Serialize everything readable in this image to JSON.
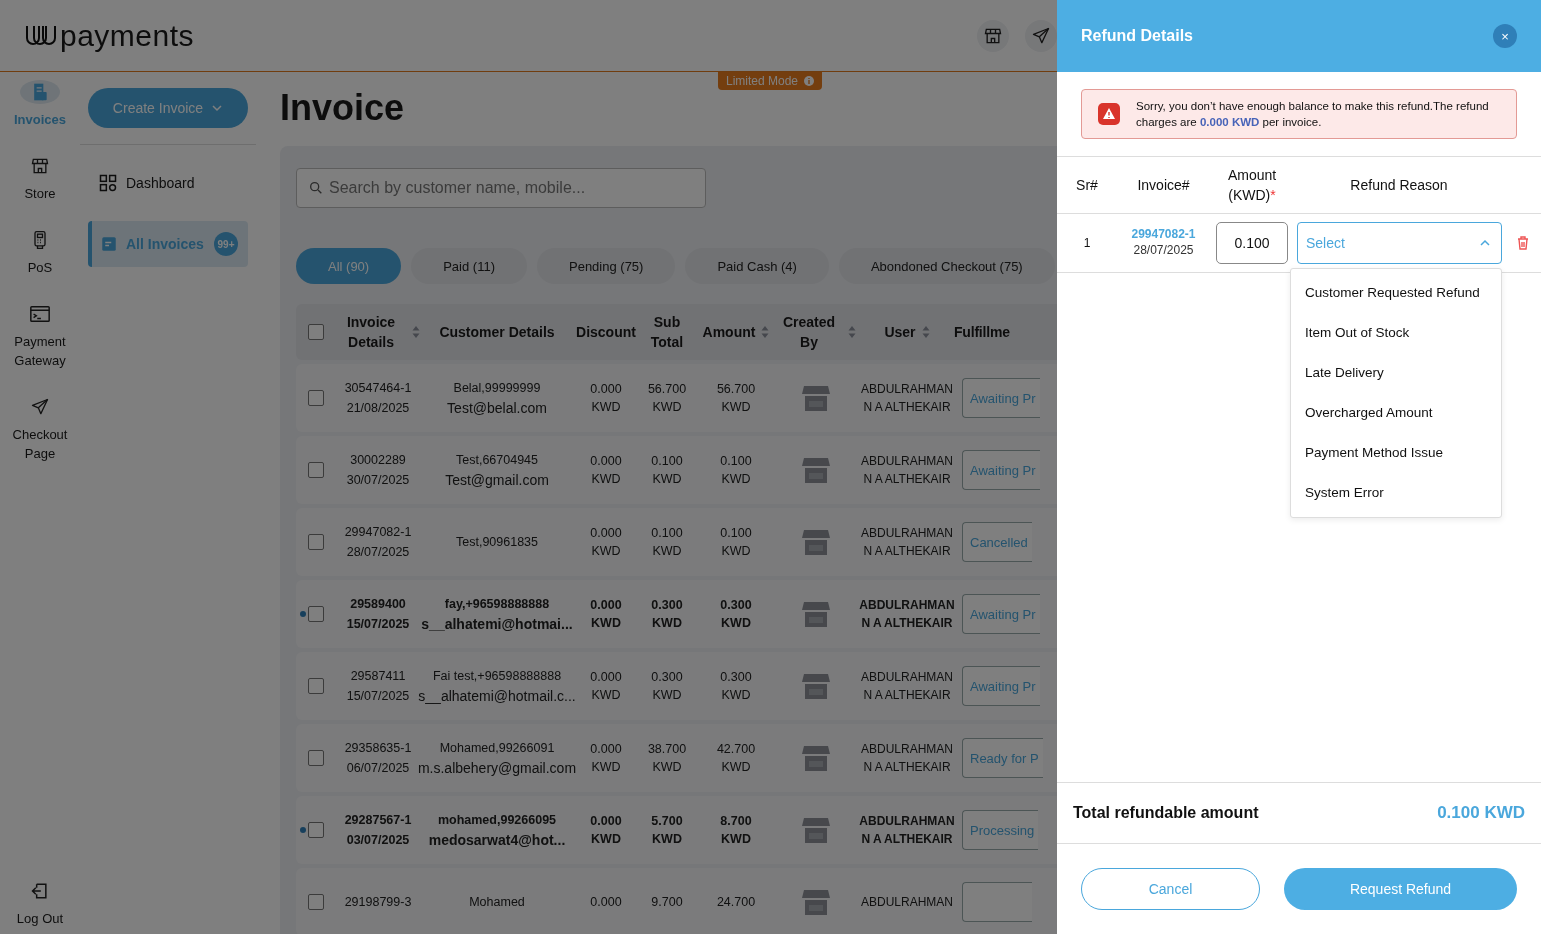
{
  "header": {
    "logo_text": "payments",
    "limited_mode": "Limited Mode"
  },
  "rail": {
    "items": [
      {
        "label": "Invoices",
        "selected": true
      },
      {
        "label": "Store",
        "selected": false
      },
      {
        "label": "PoS",
        "selected": false
      },
      {
        "label": "Payment Gateway",
        "selected": false
      },
      {
        "label": "Checkout Page",
        "selected": false
      }
    ],
    "logout": "Log Out"
  },
  "submenu": {
    "create_button": "Create Invoice",
    "items": [
      {
        "label": "Dashboard",
        "selected": false
      },
      {
        "label": "All Invoices",
        "selected": true,
        "badge": "99+"
      }
    ]
  },
  "page_title": "Invoice",
  "search": {
    "placeholder": "Search by customer name, mobile..."
  },
  "filters": [
    {
      "label": "All (90)",
      "selected": true
    },
    {
      "label": "Paid (11)",
      "selected": false
    },
    {
      "label": "Pending (75)",
      "selected": false
    },
    {
      "label": "Paid Cash (4)",
      "selected": false
    },
    {
      "label": "Abondoned Checkout (75)",
      "selected": false
    }
  ],
  "table": {
    "all_checked": false,
    "columns": [
      {
        "label": "Invoice Details",
        "sortable": true
      },
      {
        "label": "Customer Details",
        "sortable": false
      },
      {
        "label": "Discount",
        "sortable": false
      },
      {
        "label": "Sub Total",
        "sortable": false
      },
      {
        "label": "Amount",
        "sortable": true
      },
      {
        "label": "Created By",
        "sortable": true
      },
      {
        "label": "User",
        "sortable": true
      },
      {
        "label": "Fulfillme",
        "sortable": false
      }
    ],
    "rows": [
      {
        "invoice": "30547464-1",
        "date": "21/08/2025",
        "customer": "Belal,99999999",
        "email": "Test@belal.com",
        "discount": "0.000 KWD",
        "subtotal": "56.700 KWD",
        "amount": "56.700 KWD",
        "user": "ABDULRAHMAN N A ALTHEKAIR",
        "status": "Awaiting Pr",
        "unread": false,
        "checked": false
      },
      {
        "invoice": "30002289",
        "date": "30/07/2025",
        "customer": "Test,66704945",
        "email": "Test@gmail.com",
        "discount": "0.000 KWD",
        "subtotal": "0.100 KWD",
        "amount": "0.100 KWD",
        "user": "ABDULRAHMAN N A ALTHEKAIR",
        "status": "Awaiting Pr",
        "unread": false,
        "checked": false
      },
      {
        "invoice": "29947082-1",
        "date": "28/07/2025",
        "customer": "Test,90961835",
        "discount": "0.000 KWD",
        "subtotal": "0.100 KWD",
        "amount": "0.100 KWD",
        "user": "ABDULRAHMAN N A ALTHEKAIR",
        "status": "Cancelled",
        "unread": false,
        "checked": false
      },
      {
        "invoice": "29589400",
        "date": "15/07/2025",
        "customer": "fay,+96598888888",
        "email": "s__alhatemi@hotmai...",
        "discount": "0.000 KWD",
        "subtotal": "0.300 KWD",
        "amount": "0.300 KWD",
        "user": "ABDULRAHMAN N A ALTHEKAIR",
        "status": "Awaiting Pr",
        "unread": true,
        "checked": false
      },
      {
        "invoice": "29587411",
        "date": "15/07/2025",
        "customer": "Fai test,+96598888888",
        "email": "s__alhatemi@hotmail.c...",
        "discount": "0.000 KWD",
        "subtotal": "0.300 KWD",
        "amount": "0.300 KWD",
        "user": "ABDULRAHMAN N A ALTHEKAIR",
        "status": "Awaiting Pr",
        "unread": false,
        "checked": false
      },
      {
        "invoice": "29358635-1",
        "date": "06/07/2025",
        "customer": "Mohamed,99266091",
        "email": "m.s.albehery@gmail.com",
        "discount": "0.000 KWD",
        "subtotal": "38.700 KWD",
        "amount": "42.700 KWD",
        "user": "ABDULRAHMAN N A ALTHEKAIR",
        "status": "Ready for P",
        "unread": false,
        "checked": false
      },
      {
        "invoice": "29287567-1",
        "date": "03/07/2025",
        "customer": "mohamed,99266095",
        "email": "medosarwat4@hot...",
        "discount": "0.000 KWD",
        "subtotal": "5.700 KWD",
        "amount": "8.700 KWD",
        "user": "ABDULRAHMAN N A ALTHEKAIR",
        "status": "Processing",
        "unread": true,
        "checked": false
      },
      {
        "invoice": "29198799-3",
        "customer": "Mohamed",
        "discount": "0.000",
        "subtotal": "9.700",
        "amount": "24.700",
        "user": "ABDULRAHMAN",
        "unread": false,
        "checked": false
      }
    ]
  },
  "drawer": {
    "title": "Refund Details",
    "close": "×",
    "alert": "Sorry, you don’t have enough balance to make this refund.The refund charges are **0.000 KWD** per invoice.",
    "columns": [
      {
        "label": "Sr#"
      },
      {
        "label": "Invoice#"
      },
      {
        "label": "Amount (KWD)",
        "required_mark": "*"
      },
      {
        "label": "Refund Reason"
      }
    ],
    "row": {
      "sr": "1",
      "invoice": "29947082-1",
      "date": "28/07/2025",
      "amount": "0.100",
      "reason_placeholder": "Select",
      "expanded": true,
      "options": [
        "Customer Requested Refund",
        "Item Out of Stock",
        "Late Delivery",
        "Overcharged Amount",
        "Payment Method Issue",
        "System Error"
      ]
    },
    "total_label": "Total refundable amount",
    "total_value": "0.100 KWD",
    "cancel_button": "Cancel",
    "submit_button": "Request Refund"
  }
}
